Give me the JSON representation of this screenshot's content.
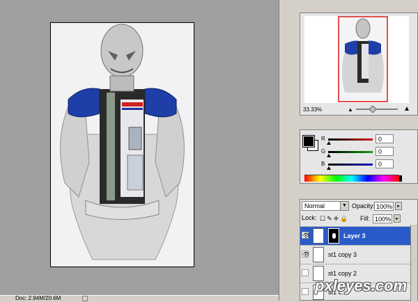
{
  "navigator": {
    "zoom": "33.33%",
    "frame_color": "#e05050"
  },
  "color": {
    "channels": [
      {
        "label": "R",
        "value": "0",
        "bar": "linear-gradient(to right,#000,#d01010)"
      },
      {
        "label": "G",
        "value": "0",
        "bar": "linear-gradient(to right,#000,#10a010)"
      },
      {
        "label": "B",
        "value": "0",
        "bar": "linear-gradient(to right,#000,#1010c0)"
      }
    ],
    "foreground": "#000000",
    "background": "#ffffff"
  },
  "layers": {
    "blend_mode": "Normal",
    "opacity_label": "Opacity:",
    "opacity": "100%",
    "lock_label": "Lock:",
    "fill_label": "Fill:",
    "fill": "100%",
    "items": [
      {
        "name": "Layer 3",
        "visible": true,
        "selected": true
      },
      {
        "name": "st1 copy 3",
        "visible": true,
        "selected": false
      },
      {
        "name": "st1 copy 2",
        "visible": false,
        "selected": false
      },
      {
        "name": "st1 c...",
        "visible": false,
        "selected": false
      }
    ]
  },
  "status": {
    "doc": "Doc: 2.94M/20.6M"
  },
  "watermark": "pxleyes.com",
  "accent": "#2a5cc9"
}
